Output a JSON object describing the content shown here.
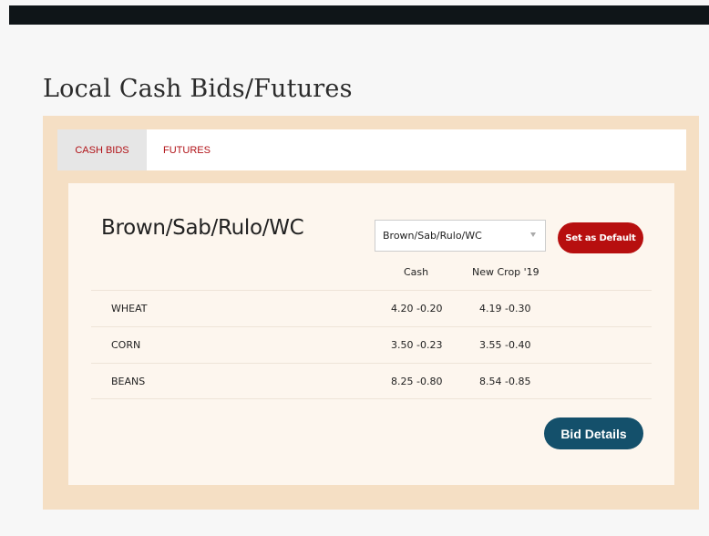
{
  "header": {
    "title": "Local Cash Bids/Futures"
  },
  "tabs": [
    {
      "label": "CASH BIDS",
      "active": true
    },
    {
      "label": "FUTURES",
      "active": false
    }
  ],
  "location": {
    "title": "Brown/Sab/Rulo/WC",
    "select_value": "Brown/Sab/Rulo/WC",
    "set_default_label": "Set as Default"
  },
  "table": {
    "columns": [
      "Cash",
      "New Crop '19"
    ],
    "rows": [
      {
        "commodity": "WHEAT",
        "cash": "4.20 -0.20",
        "new_crop": "4.19 -0.30"
      },
      {
        "commodity": "CORN",
        "cash": "3.50 -0.23",
        "new_crop": "3.55 -0.40"
      },
      {
        "commodity": "BEANS",
        "cash": "8.25 -0.80",
        "new_crop": "8.54 -0.85"
      }
    ]
  },
  "actions": {
    "bid_details_label": "Bid Details"
  },
  "colors": {
    "accent_red": "#b70f0f",
    "details_blue": "#14506b",
    "widget_bg": "#f5dfc4",
    "topbar": "#0f1518"
  }
}
